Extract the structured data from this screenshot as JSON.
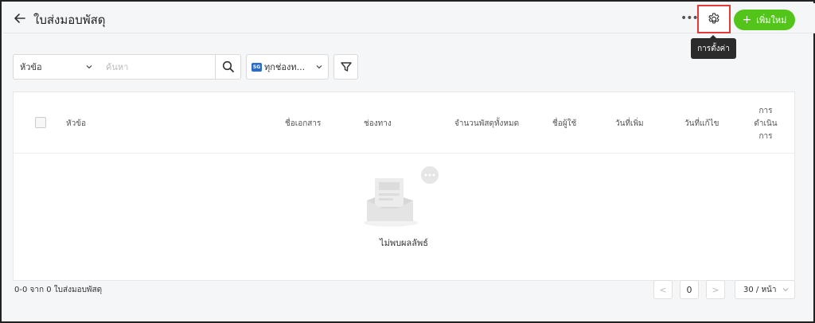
{
  "header": {
    "title": "ใบส่งมอบพัสดุ",
    "more_label": "•••",
    "add_button_label": "เพิ่มใหม่",
    "add_button_plus": "+",
    "settings_tooltip": "การตั้งค่า"
  },
  "filters": {
    "field_select_value": "หัวข้อ",
    "search_placeholder": "ค้นหา",
    "search_value": "",
    "channel_badge": "SG",
    "channel_select_value": "ทุกช่องท...",
    "dropdown_arrow": "⌄"
  },
  "table": {
    "columns": {
      "subject": "หัวข้อ",
      "document_name": "ชื่อเอกสาร",
      "channel": "ช่องทาง",
      "total_parcels": "จำนวนพัสดุทั้งหมด",
      "user_name": "ชื่อผู้ใช้",
      "date_added": "วันที่เพิ่ม",
      "date_modified": "วันที่แก้ไข",
      "action_line1": "การ",
      "action_line2": "ดำเนิน",
      "action_line3": "การ"
    },
    "empty_text": "ไม่พบผลลัพธ์"
  },
  "footer": {
    "summary": "0-0 จาก 0 ใบส่งมอบพัสดุ",
    "prev": "<",
    "current_page": "0",
    "next": ">",
    "page_size": "30 / หน้า"
  },
  "colors": {
    "accent_green": "#52c41a",
    "highlight_red": "#e53935",
    "tooltip_bg": "#2b2b2b"
  }
}
